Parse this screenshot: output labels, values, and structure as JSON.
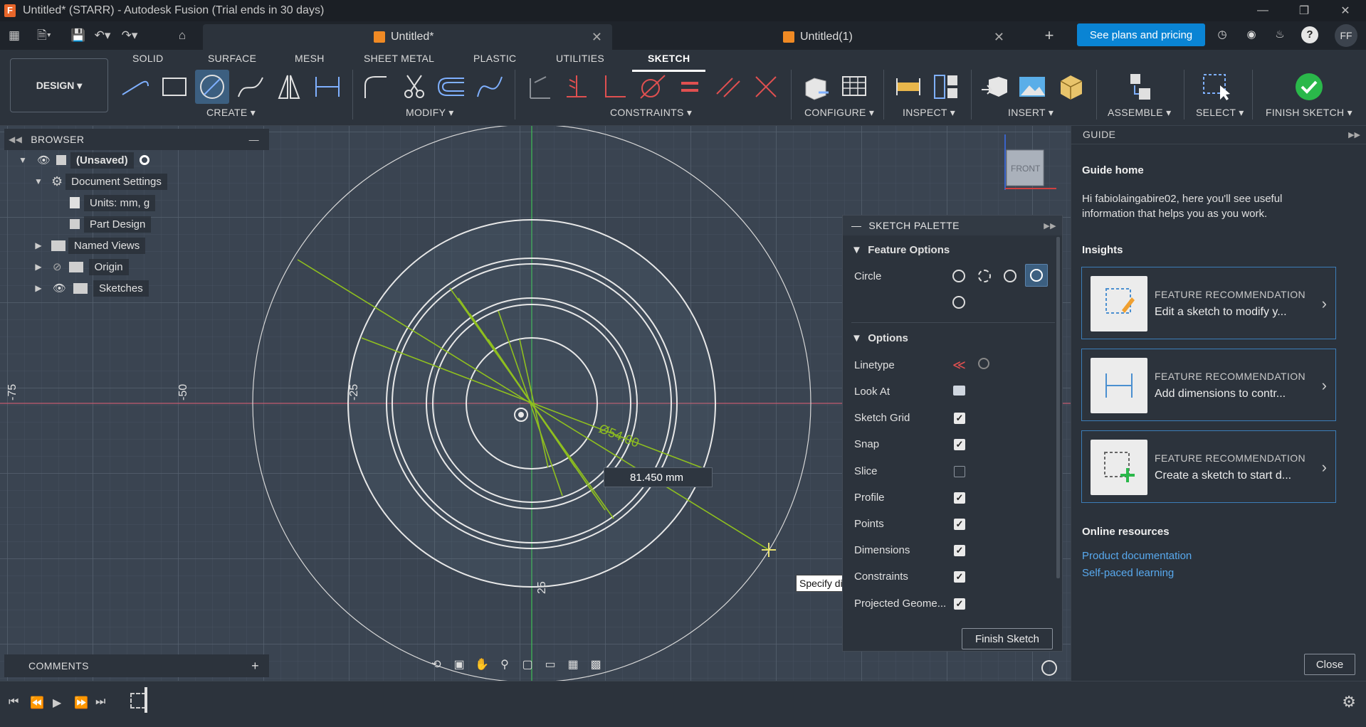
{
  "window": {
    "title": "Untitled* (STARR) - Autodesk Fusion (Trial ends in 30 days)",
    "app_letter": "F"
  },
  "tabs": [
    {
      "label": "Untitled*"
    },
    {
      "label": "Untitled(1)"
    }
  ],
  "header": {
    "plans_label": "See plans and pricing",
    "avatar": "FF"
  },
  "toolbar": {
    "design_label": "DESIGN",
    "workspace_tabs": [
      "SOLID",
      "SURFACE",
      "MESH",
      "SHEET METAL",
      "PLASTIC",
      "UTILITIES",
      "SKETCH"
    ],
    "active_tab": "SKETCH",
    "groups": [
      "CREATE",
      "MODIFY",
      "CONSTRAINTS",
      "CONFIGURE",
      "INSPECT",
      "INSERT",
      "ASSEMBLE",
      "SELECT",
      "FINISH SKETCH"
    ]
  },
  "browser": {
    "title": "BROWSER",
    "root": "(Unsaved)",
    "items": [
      {
        "label": "Document Settings"
      },
      {
        "label": "Units: mm, g"
      },
      {
        "label": "Part Design"
      },
      {
        "label": "Named Views"
      },
      {
        "label": "Origin"
      },
      {
        "label": "Sketches"
      }
    ]
  },
  "canvas": {
    "ruler_labels": [
      "-75",
      "-50",
      "-25",
      "25"
    ],
    "dimension_label": "Ø54.00",
    "dimension_input": "81.450 mm",
    "tooltip": "Specify diameter of circle",
    "viewcube_label": "FRONT"
  },
  "palette": {
    "title": "SKETCH PALETTE",
    "feature_options": "Feature Options",
    "circle_label": "Circle",
    "options_label": "Options",
    "rows": [
      {
        "label": "Linetype"
      },
      {
        "label": "Look At"
      },
      {
        "label": "Sketch Grid",
        "checked": true
      },
      {
        "label": "Snap",
        "checked": true
      },
      {
        "label": "Slice",
        "checked": false
      },
      {
        "label": "Profile",
        "checked": true
      },
      {
        "label": "Points",
        "checked": true
      },
      {
        "label": "Dimensions",
        "checked": true
      },
      {
        "label": "Constraints",
        "checked": true
      },
      {
        "label": "Projected Geome...",
        "checked": true
      }
    ],
    "finish_label": "Finish Sketch"
  },
  "guide": {
    "title": "GUIDE",
    "home": "Guide home",
    "intro": "Hi fabiolaingabire02, here you'll see useful information that helps you as you work.",
    "insights": "Insights",
    "cards": [
      {
        "kicker": "FEATURE RECOMMENDATION",
        "text": "Edit a sketch to modify y..."
      },
      {
        "kicker": "FEATURE RECOMMENDATION",
        "text": "Add dimensions to contr..."
      },
      {
        "kicker": "FEATURE RECOMMENDATION",
        "text": "Create a sketch to start d..."
      }
    ],
    "online": "Online resources",
    "links": [
      "Product documentation",
      "Self-paced learning"
    ],
    "close_label": "Close"
  },
  "comments": {
    "title": "COMMENTS"
  },
  "colors": {
    "accent": "#0a84d4",
    "sketch_line": "#ffffff",
    "dimension": "#8fbf1f",
    "canvas": "#3a4451"
  }
}
